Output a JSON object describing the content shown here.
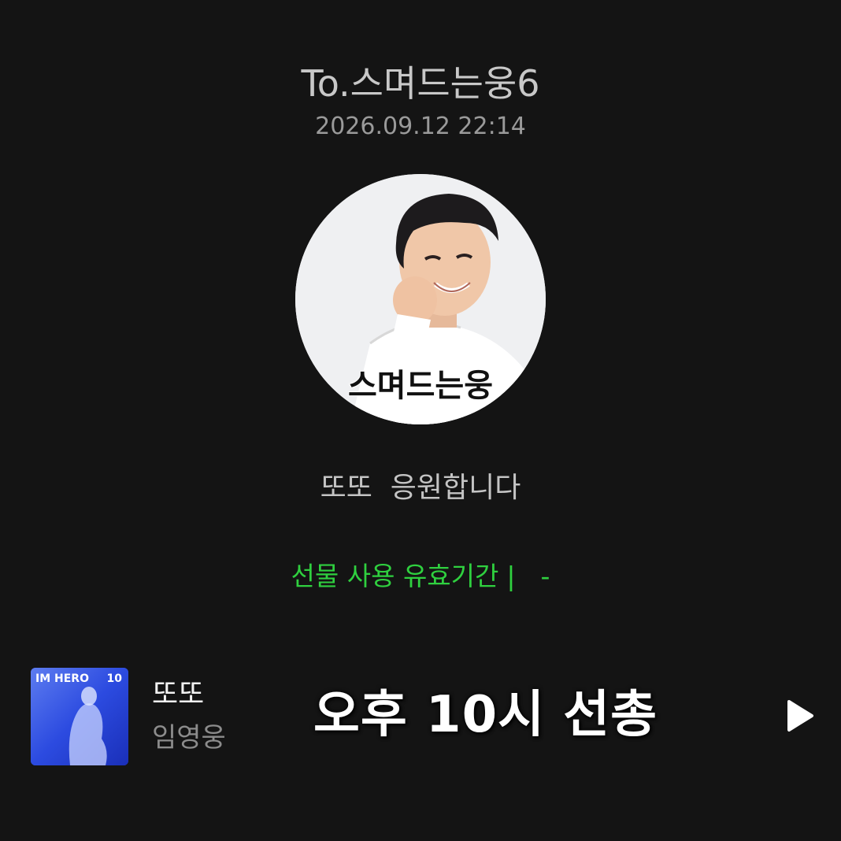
{
  "header": {
    "recipient": "To.스며드는웅6",
    "timestamp": "2026.09.12 22:14"
  },
  "profile": {
    "avatar_caption": "스며드는웅"
  },
  "message": {
    "text": "또또  응원합니다"
  },
  "gift": {
    "validity_label": "선물 사용 유효기간",
    "separator": "|",
    "validity_value": "-",
    "accent_color": "#2fd03f"
  },
  "music": {
    "album_text_left": "IM HERO",
    "album_text_right": "10",
    "song_title": "또또",
    "artist": "임영웅",
    "overlay_text": "오후 10시 선총",
    "play_icon": "play-icon"
  }
}
